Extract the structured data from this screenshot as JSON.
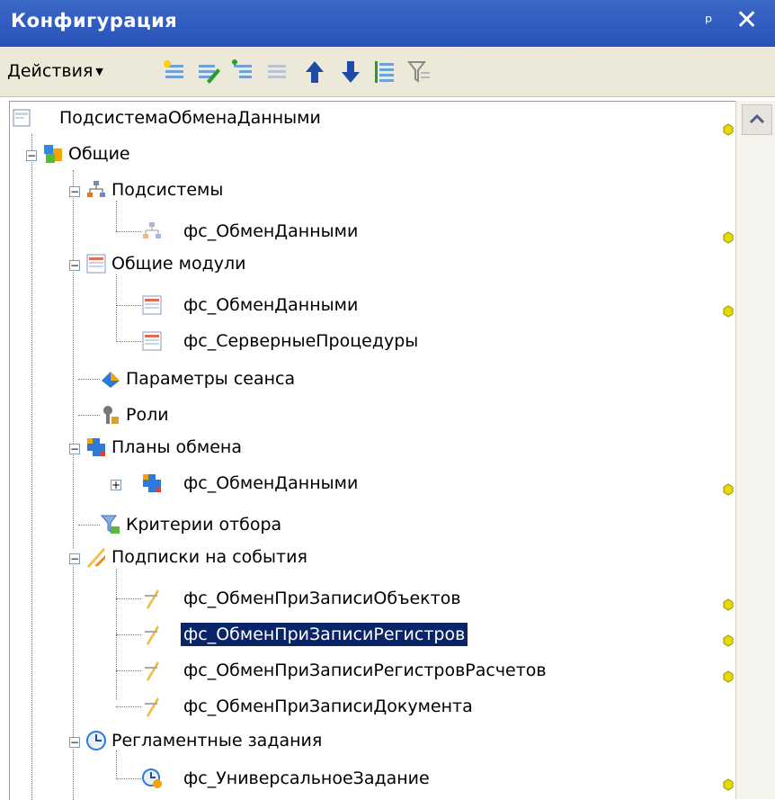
{
  "window": {
    "title": "Конфигурация",
    "pin_glyph": "ᵖ",
    "close_glyph": "✕"
  },
  "toolbar": {
    "actions_label": "Действия",
    "actions_arrow": "▼",
    "icons": [
      "add-item-icon",
      "add-with-edit-icon",
      "add-child-icon",
      "copy-item-icon",
      "move-up-icon",
      "move-down-icon",
      "sort-icon",
      "filter-icon"
    ]
  },
  "tree": {
    "root": "ПодсистемаОбменаДанными",
    "items": [
      {
        "label": "Общие"
      },
      {
        "label": "Подсистемы"
      },
      {
        "label": "фс_ОбменДанными"
      },
      {
        "label": "Общие модули"
      },
      {
        "label": "фс_ОбменДанными"
      },
      {
        "label": "фс_СерверныеПроцедуры"
      },
      {
        "label": "Параметры сеанса"
      },
      {
        "label": "Роли"
      },
      {
        "label": "Планы обмена"
      },
      {
        "label": "фс_ОбменДанными"
      },
      {
        "label": "Критерии отбора"
      },
      {
        "label": "Подписки на события"
      },
      {
        "label": "фс_ОбменПриЗаписиОбъектов"
      },
      {
        "label": "фс_ОбменПриЗаписиРегистров",
        "selected": true
      },
      {
        "label": "фс_ОбменПриЗаписиРегистровРасчетов"
      },
      {
        "label": "фс_ОбменПриЗаписиДокумента"
      },
      {
        "label": "Регламентные задания"
      },
      {
        "label": "фс_УниверсальноеЗадание"
      }
    ]
  },
  "colors": {
    "title_bar": "#2852b8",
    "selection": "#0a246a",
    "toolbar_bg": "#ece9d8"
  }
}
